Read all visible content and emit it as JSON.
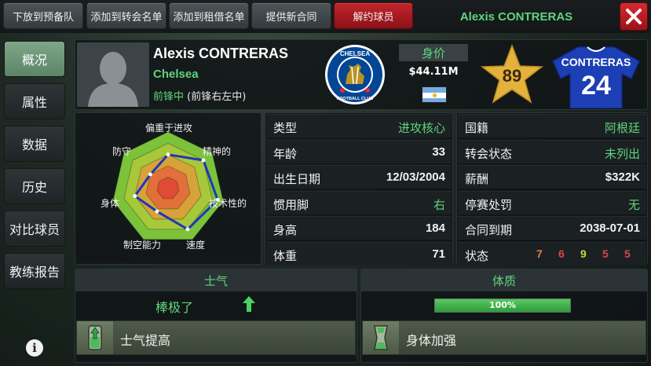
{
  "top_buttons": {
    "release_to_reserve": "下放到预备队",
    "add_transfer_list": "添加到转会名单",
    "add_loan_list": "添加到租借名单",
    "offer_contract": "提供新合同",
    "terminate": "解约球员"
  },
  "window_title": "Alexis CONTRERAS",
  "close_icon": "close-icon",
  "sidebar": {
    "items": [
      {
        "label": "概况",
        "active": true
      },
      {
        "label": "属性",
        "active": false
      },
      {
        "label": "数据",
        "active": false
      },
      {
        "label": "历史",
        "active": false
      },
      {
        "label": "对比球员",
        "active": false
      },
      {
        "label": "教练报告",
        "active": false
      }
    ],
    "info_icon": "info-icon"
  },
  "player": {
    "name": "Alexis CONTRERAS",
    "club": "Chelsea",
    "position_main": "前锋中",
    "position_extra": "(前锋右左中)",
    "value_label": "身价",
    "value": "$44.11M",
    "nationality_flag": "argentina-flag-icon",
    "rating": "89",
    "shirt_name": "CONTRERAS",
    "shirt_number": "24"
  },
  "club_crest": {
    "line1": "CHELSEA",
    "line2": "FOOTBALL CLUB"
  },
  "radar": {
    "labels": [
      "偏重于进攻",
      "精神的",
      "技术性的",
      "速度",
      "制空能力",
      "身体",
      "防守"
    ],
    "values": [
      0.6,
      0.8,
      0.9,
      0.8,
      0.45,
      0.6,
      0.4
    ]
  },
  "stats_left": [
    {
      "key": "类型",
      "value": "进攻核心",
      "style": "green"
    },
    {
      "key": "年龄",
      "value": "33",
      "style": "white"
    },
    {
      "key": "出生日期",
      "value": "12/03/2004",
      "style": "white"
    },
    {
      "key": "惯用脚",
      "value": "右",
      "style": "green"
    },
    {
      "key": "身高",
      "value": "184",
      "style": "white"
    },
    {
      "key": "体重",
      "value": "71",
      "style": "white"
    }
  ],
  "stats_right": [
    {
      "key": "国籍",
      "value": "阿根廷",
      "style": "green"
    },
    {
      "key": "转会状态",
      "value": "未列出",
      "style": "green"
    },
    {
      "key": "薪酬",
      "value": "$322K",
      "style": "white"
    },
    {
      "key": "停赛处罚",
      "value": "无",
      "style": "green"
    },
    {
      "key": "合同到期",
      "value": "2038-07-01",
      "style": "white"
    },
    {
      "key": "状态",
      "value": "",
      "style": "white"
    }
  ],
  "form": [
    {
      "value": "7",
      "color": "#e0803a"
    },
    {
      "value": "6",
      "color": "#e04545"
    },
    {
      "value": "9",
      "color": "#c8d836"
    },
    {
      "value": "5",
      "color": "#e04545"
    },
    {
      "value": "5",
      "color": "#e04545"
    }
  ],
  "morale": {
    "title": "士气",
    "value": "棒极了",
    "trend": "up-arrow-icon",
    "boost_label": "士气提高"
  },
  "fitness": {
    "title": "体质",
    "percent_label": "100%",
    "level": 1.0,
    "boost_label": "身体加强"
  },
  "colors": {
    "accent_green": "#5fd57c",
    "terminate_red": "#c0262c",
    "shirt_blue": "#1d3fb5",
    "star_gold": "#e3b23c"
  }
}
